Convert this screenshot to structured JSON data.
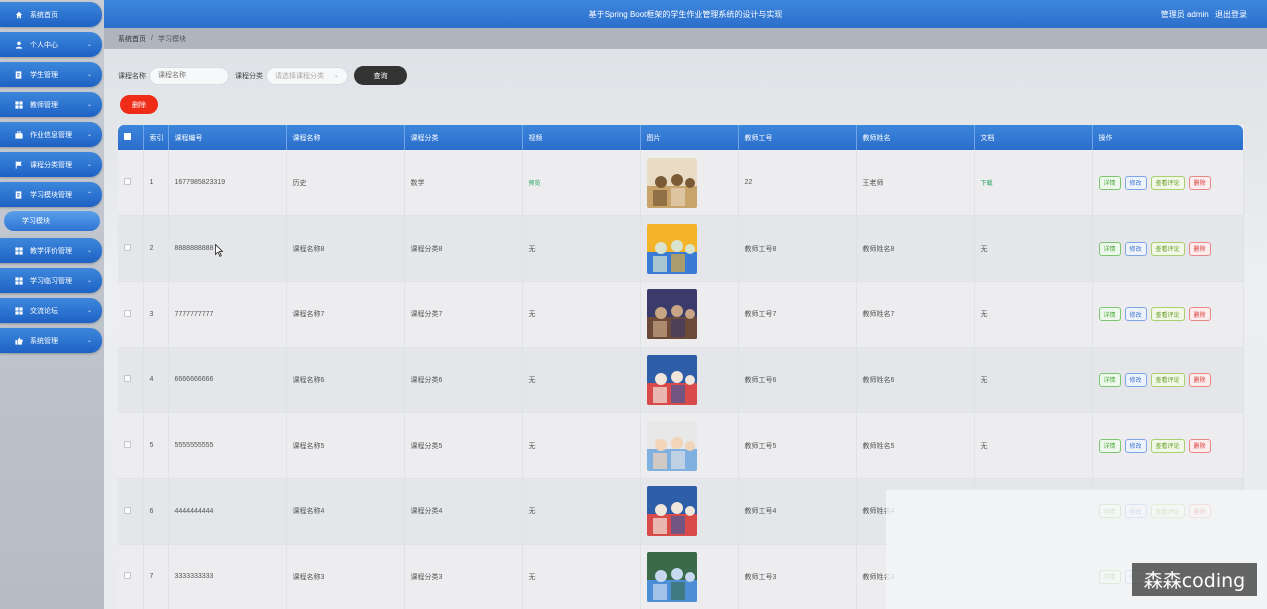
{
  "app": {
    "title": "基于Spring Boot框架的学生作业管理系统的设计与实现",
    "user_role": "管理员 admin",
    "logout": "退出登录"
  },
  "sidebar": {
    "items": [
      {
        "label": "系统首页",
        "icon": "home-icon"
      },
      {
        "label": "个人中心",
        "icon": "user-icon"
      },
      {
        "label": "学生管理",
        "icon": "document-icon"
      },
      {
        "label": "教师管理",
        "icon": "grid-icon"
      },
      {
        "label": "作业信息管理",
        "icon": "briefcase-icon"
      },
      {
        "label": "课程分类管理",
        "icon": "flag-icon"
      },
      {
        "label": "学习模块管理",
        "icon": "document-icon"
      },
      {
        "label": "学习模块",
        "icon": ""
      },
      {
        "label": "教学评价管理",
        "icon": "grid-icon"
      },
      {
        "label": "学习临习管理",
        "icon": "grid-icon"
      },
      {
        "label": "交流论坛",
        "icon": "grid-icon"
      },
      {
        "label": "系统管理",
        "icon": "thumbs-up-icon"
      }
    ]
  },
  "breadcrumb": {
    "home": "系统首页",
    "separator": "/",
    "current": "学习模块"
  },
  "search": {
    "course_name_label": "课程名称",
    "course_name_placeholder": "课程名称",
    "course_category_label": "课程分类",
    "course_category_placeholder": "请选择课程分类",
    "query_button": "查询"
  },
  "delete_button": "删除",
  "table": {
    "headers": [
      "索引",
      "课程编号",
      "课程名称",
      "课程分类",
      "视频",
      "图片",
      "教师工号",
      "教师姓名",
      "文档",
      "操作"
    ],
    "ops": {
      "detail": "详情",
      "edit": "修改",
      "review": "查看评论",
      "delete": "删除"
    },
    "rows": [
      {
        "index": "1",
        "code": "1677985823319",
        "name": "历史",
        "category": "数学",
        "video": "预览",
        "teacher_id": "22",
        "teacher_name": "王老师",
        "doc": "下载"
      },
      {
        "index": "2",
        "code": "8888888888",
        "name": "课程名称8",
        "category": "课程分类8",
        "video": "无",
        "teacher_id": "教师工号8",
        "teacher_name": "教师姓名8",
        "doc": "无"
      },
      {
        "index": "3",
        "code": "7777777777",
        "name": "课程名称7",
        "category": "课程分类7",
        "video": "无",
        "teacher_id": "教师工号7",
        "teacher_name": "教师姓名7",
        "doc": "无"
      },
      {
        "index": "4",
        "code": "6666666666",
        "name": "课程名称6",
        "category": "课程分类6",
        "video": "无",
        "teacher_id": "教师工号6",
        "teacher_name": "教师姓名6",
        "doc": "无"
      },
      {
        "index": "5",
        "code": "5555555555",
        "name": "课程名称5",
        "category": "课程分类5",
        "video": "无",
        "teacher_id": "教师工号5",
        "teacher_name": "教师姓名5",
        "doc": "无"
      },
      {
        "index": "6",
        "code": "4444444444",
        "name": "课程名称4",
        "category": "课程分类4",
        "video": "无",
        "teacher_id": "教师工号4",
        "teacher_name": "教师姓名4",
        "doc": ""
      },
      {
        "index": "7",
        "code": "3333333333",
        "name": "课程名称3",
        "category": "课程分类3",
        "video": "无",
        "teacher_id": "教师工号3",
        "teacher_name": "教师姓名3",
        "doc": ""
      }
    ]
  },
  "watermark": "森森coding",
  "colors": {
    "primary_blue": "#2c6fcc",
    "danger_red": "#ee2c17",
    "query_dark": "#333333",
    "link_green": "#23a35a"
  }
}
